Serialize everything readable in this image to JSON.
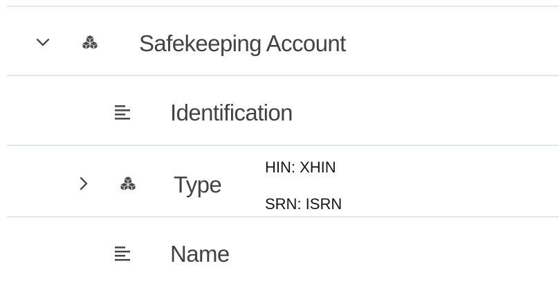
{
  "tree": {
    "rows": [
      {
        "label": "Safekeeping Account",
        "icon": "cube-group-icon",
        "expander": "chevron-down-icon",
        "expanded": true
      },
      {
        "label": "Identification",
        "icon": "text-lines-icon"
      },
      {
        "label": "Type",
        "icon": "cube-group-icon",
        "expander": "chevron-right-icon",
        "expanded": false,
        "details": [
          "HIN: XHIN",
          "SRN: ISRN"
        ]
      },
      {
        "label": "Name",
        "icon": "text-lines-icon"
      }
    ]
  },
  "colors": {
    "divider": "#e3e6ea",
    "label": "#424242",
    "icon": "#4a4a4a",
    "detail_text": "#151515"
  }
}
